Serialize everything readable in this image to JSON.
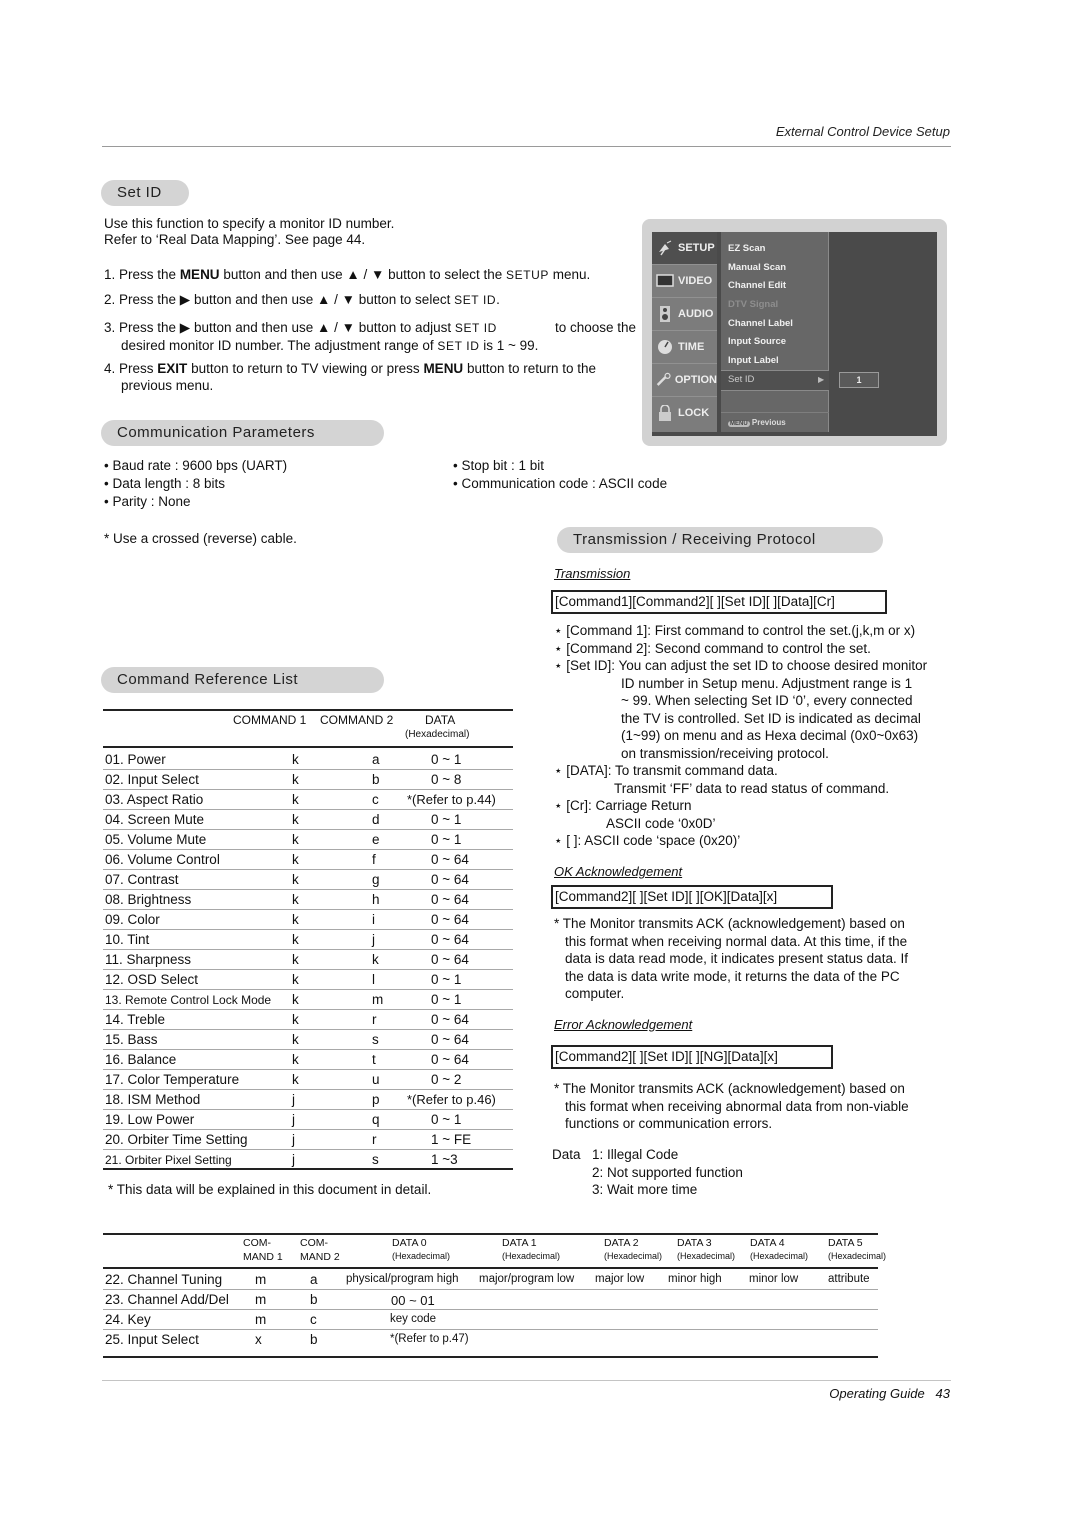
{
  "header": {
    "section_title": "External Control Device Setup"
  },
  "set_id": {
    "heading": "Set ID",
    "intro": [
      "Use this function to specify a monitor ID number.",
      "Refer to ‘Real Data Mapping’. See page 44."
    ],
    "steps": [
      {
        "num": "1.",
        "pre": "Press the ",
        "bold1": "MENU",
        "mid": " button and then use ▲ / ▼  button to select the ",
        "sc": "SETUP",
        "post": " menu."
      },
      {
        "num": "2.",
        "pre": "Press the ▶ button and then use ▲ / ▼  button to select ",
        "sc": "SET ID",
        "post": "."
      },
      {
        "num": "3.",
        "line1_pre": "Press the ▶ button and then use ▲ / ▼ button to adjust ",
        "line1_sc": "SET ID",
        "line1_post": " to choose the",
        "line2_pre": "desired monitor ID number. The adjustment range of ",
        "line2_sc": "SET ID",
        "line2_post": " is 1 ~ 99."
      },
      {
        "num": "4.",
        "pre": "Press ",
        "bold1": "EXIT",
        "mid": " button to return to TV viewing or press ",
        "bold2": "MENU",
        "post": " button to return to the",
        "line2": "previous menu."
      }
    ]
  },
  "osd_menu": {
    "tabs": [
      {
        "label": "SETUP",
        "icon": "satellite-icon",
        "active": true
      },
      {
        "label": "VIDEO",
        "icon": "screen-icon",
        "active": false
      },
      {
        "label": "AUDIO",
        "icon": "speaker-icon",
        "active": false
      },
      {
        "label": "TIME",
        "icon": "clock-icon",
        "active": false
      },
      {
        "label": "OPTION",
        "icon": "wrench-icon",
        "active": false
      },
      {
        "label": "LOCK",
        "icon": "padlock-icon",
        "active": false
      }
    ],
    "items": [
      {
        "label": "EZ Scan",
        "enabled": true
      },
      {
        "label": "Manual Scan",
        "enabled": true
      },
      {
        "label": "Channel Edit",
        "enabled": true
      },
      {
        "label": "DTV Signal",
        "enabled": false
      },
      {
        "label": "Channel Label",
        "enabled": true
      },
      {
        "label": "Input Source",
        "enabled": true
      },
      {
        "label": "Input Label",
        "enabled": true
      },
      {
        "label": "Set ID",
        "enabled": true,
        "selected": true
      }
    ],
    "selected_value": "1",
    "footer_key": "MENU",
    "footer_label": "Previous"
  },
  "comm_params": {
    "heading": "Communication Parameters",
    "left": [
      "• Baud rate : 9600 bps (UART)",
      "• Data length : 8 bits",
      "• Parity : None"
    ],
    "right": [
      "• Stop bit : 1 bit",
      "• Communication code : ASCII code"
    ],
    "note": "* Use a crossed (reverse) cable."
  },
  "command_ref": {
    "heading": "Command Reference List",
    "columns": {
      "cmd1": "COMMAND 1",
      "cmd2": "COMMAND 2",
      "data": "DATA",
      "data_sub": "(Hexadecimal)"
    },
    "rows": [
      [
        "01. Power",
        "k",
        "a",
        "0 ~ 1"
      ],
      [
        "02. Input Select",
        "k",
        "b",
        "0 ~ 8"
      ],
      [
        "03. Aspect Ratio",
        "k",
        "c",
        "*(Refer to p.44)"
      ],
      [
        "04. Screen Mute",
        "k",
        "d",
        "0 ~ 1"
      ],
      [
        "05. Volume Mute",
        "k",
        "e",
        "0 ~ 1"
      ],
      [
        "06. Volume Control",
        "k",
        "f",
        "0 ~ 64"
      ],
      [
        "07. Contrast",
        "k",
        "g",
        "0 ~ 64"
      ],
      [
        "08. Brightness",
        "k",
        "h",
        "0 ~ 64"
      ],
      [
        "09. Color",
        "k",
        "i",
        "0 ~ 64"
      ],
      [
        "10. Tint",
        "k",
        "j",
        "0 ~ 64"
      ],
      [
        "11. Sharpness",
        "k",
        "k",
        "0 ~ 64"
      ],
      [
        "12. OSD Select",
        "k",
        "l",
        "0 ~ 1"
      ],
      [
        "13. Remote Control Lock Mode",
        "k",
        "m",
        "0 ~ 1"
      ],
      [
        "14. Treble",
        "k",
        "r",
        "0 ~ 64"
      ],
      [
        "15. Bass",
        "k",
        "s",
        "0 ~ 64"
      ],
      [
        "16. Balance",
        "k",
        "t",
        "0 ~ 64"
      ],
      [
        "17. Color Temperature",
        "k",
        "u",
        "0 ~ 2"
      ],
      [
        "18. ISM Method",
        "j",
        "p",
        "*(Refer to p.46)"
      ],
      [
        "19. Low Power",
        "j",
        "q",
        "0 ~ 1"
      ],
      [
        "20. Orbiter Time Setting",
        "j",
        "r",
        "1 ~ FE"
      ],
      [
        "21. Orbiter Pixel Setting",
        "j",
        "s",
        "1 ~3"
      ]
    ],
    "footnote": "* This data will be explained in this document in detail."
  },
  "protocol": {
    "heading": "Transmission / Receiving  Protocol",
    "transmission_label": "Transmission",
    "transmission_format": "[Command1][Command2][   ][Set ID][   ][Data][Cr]",
    "notes": [
      {
        "key": "⋆ [Command 1]: ",
        "lines": [
          "First command to control the set.(j,k,m or x)"
        ]
      },
      {
        "key": "⋆ [Command 2]: ",
        "lines": [
          "Second command to control the set."
        ]
      },
      {
        "key": "⋆ [Set ID]: ",
        "lines": [
          "You can adjust the set ID to choose desired monitor",
          "ID number in Setup menu. Adjustment range is 1",
          "~ 99. When selecting Set ID ‘0’, every connected",
          "the TV is controlled. Set ID is indicated as decimal",
          "(1~99) on menu and as Hexa decimal (0x0~0x63)",
          "on transmission/receiving protocol."
        ]
      },
      {
        "key": "⋆ [DATA]: ",
        "lines": [
          "To transmit command data.",
          "Transmit ‘FF’ data to read status of command."
        ]
      },
      {
        "key": "⋆ [Cr]: ",
        "lines": [
          "Carriage Return",
          "ASCII code ‘0x0D’"
        ]
      },
      {
        "key": "⋆ [   ]: ",
        "lines": [
          "ASCII code ‘space (0x20)’"
        ]
      }
    ],
    "ok_label": "OK Acknowledgement",
    "ok_format": "[Command2][   ][Set ID][   ][OK][Data][x]",
    "ok_note": [
      "* The Monitor transmits ACK (acknowledgement) based on",
      "this format when receiving normal data. At this time, if the",
      "data is data read mode, it indicates present status data. If",
      "the data is data write mode, it returns the data of the PC",
      "computer."
    ],
    "error_label": "Error Acknowledgement",
    "error_format": "[Command2][   ][Set ID][   ][NG][Data][x]",
    "error_note": [
      "* The Monitor transmits ACK (acknowledgement) based on",
      "this format when receiving abnormal data from non-viable",
      "functions or communication errors."
    ],
    "data_codes_label": "Data",
    "data_codes": [
      "1: Illegal Code",
      "2: Not supported function",
      "3: Wait more time"
    ]
  },
  "extended_table": {
    "columns": [
      {
        "top": "COM-",
        "bottom": "MAND 1"
      },
      {
        "top": "COM-",
        "bottom": "MAND 2"
      },
      {
        "top": "DATA 0",
        "bottom": "(Hexadecimal)"
      },
      {
        "top": "DATA 1",
        "bottom": "(Hexadecimal)"
      },
      {
        "top": "DATA 2",
        "bottom": "(Hexadecimal)"
      },
      {
        "top": "DATA 3",
        "bottom": "(Hexadecimal)"
      },
      {
        "top": "DATA 4",
        "bottom": "(Hexadecimal)"
      },
      {
        "top": "DATA 5",
        "bottom": "(Hexadecimal)"
      }
    ],
    "rows": [
      {
        "name": "22. Channel Tuning",
        "c1": "m",
        "c2": "a",
        "d0": "physical/program high",
        "d1": "major/program low",
        "d2": "major low",
        "d3": "minor high",
        "d4": "minor low",
        "d5": "attribute"
      },
      {
        "name": "23. Channel Add/Del",
        "c1": "m",
        "c2": "b",
        "d0": "00 ~ 01"
      },
      {
        "name": "24. Key",
        "c1": "m",
        "c2": "c",
        "d0": "key code"
      },
      {
        "name": "25. Input Select",
        "c1": "x",
        "c2": "b",
        "d0": "*(Refer to p.47)"
      }
    ]
  },
  "footer": {
    "guide": "Operating Guide",
    "page": "43"
  }
}
